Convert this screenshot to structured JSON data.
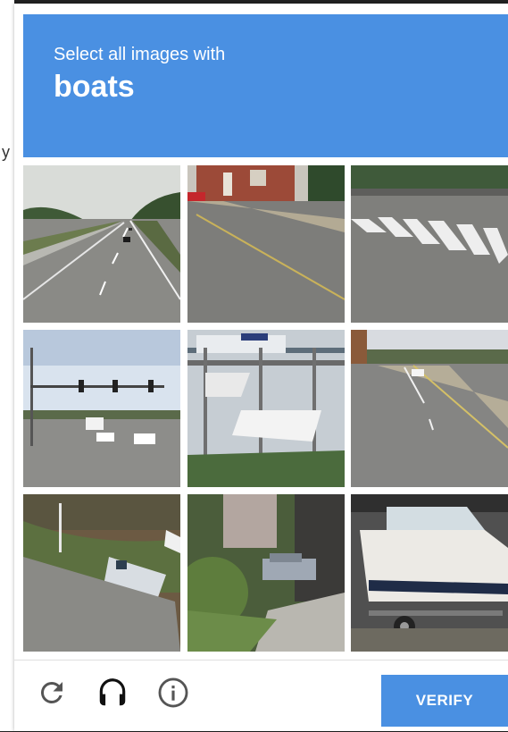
{
  "background": {
    "partial_text": "y"
  },
  "header": {
    "instruction": "Select all images with",
    "target": "boats",
    "color": "#4a90e2"
  },
  "grid": {
    "tiles": [
      {
        "index": 1,
        "depicts": "highway-road"
      },
      {
        "index": 2,
        "depicts": "street-with-building"
      },
      {
        "index": 3,
        "depicts": "crosswalk"
      },
      {
        "index": 4,
        "depicts": "intersection-traffic-lights"
      },
      {
        "index": 5,
        "depicts": "boat-storage-rack"
      },
      {
        "index": 6,
        "depicts": "city-street"
      },
      {
        "index": 7,
        "depicts": "boat-on-embankment"
      },
      {
        "index": 8,
        "depicts": "parked-car-trees"
      },
      {
        "index": 9,
        "depicts": "boat-on-trailer"
      }
    ]
  },
  "footer": {
    "icons": [
      "reload-icon",
      "headphones-icon",
      "info-icon"
    ],
    "verify_label": "VERIFY"
  }
}
